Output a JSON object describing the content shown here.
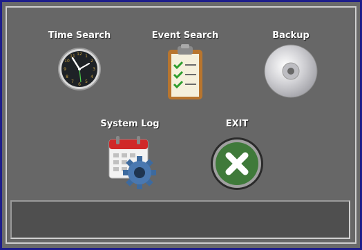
{
  "menu": {
    "time_search": "Time Search",
    "event_search": "Event Search",
    "backup": "Backup",
    "system_log": "System Log",
    "exit": "EXIT"
  },
  "icons": {
    "time_search": "clock-icon",
    "event_search": "clipboard-checklist-icon",
    "backup": "disc-icon",
    "system_log": "calendar-gear-icon",
    "exit": "close-icon"
  },
  "colors": {
    "background": "#676767",
    "outer_border": "#1e1e8a",
    "exit_green": "#3f7a3a",
    "check_green": "#2e9e2e"
  }
}
